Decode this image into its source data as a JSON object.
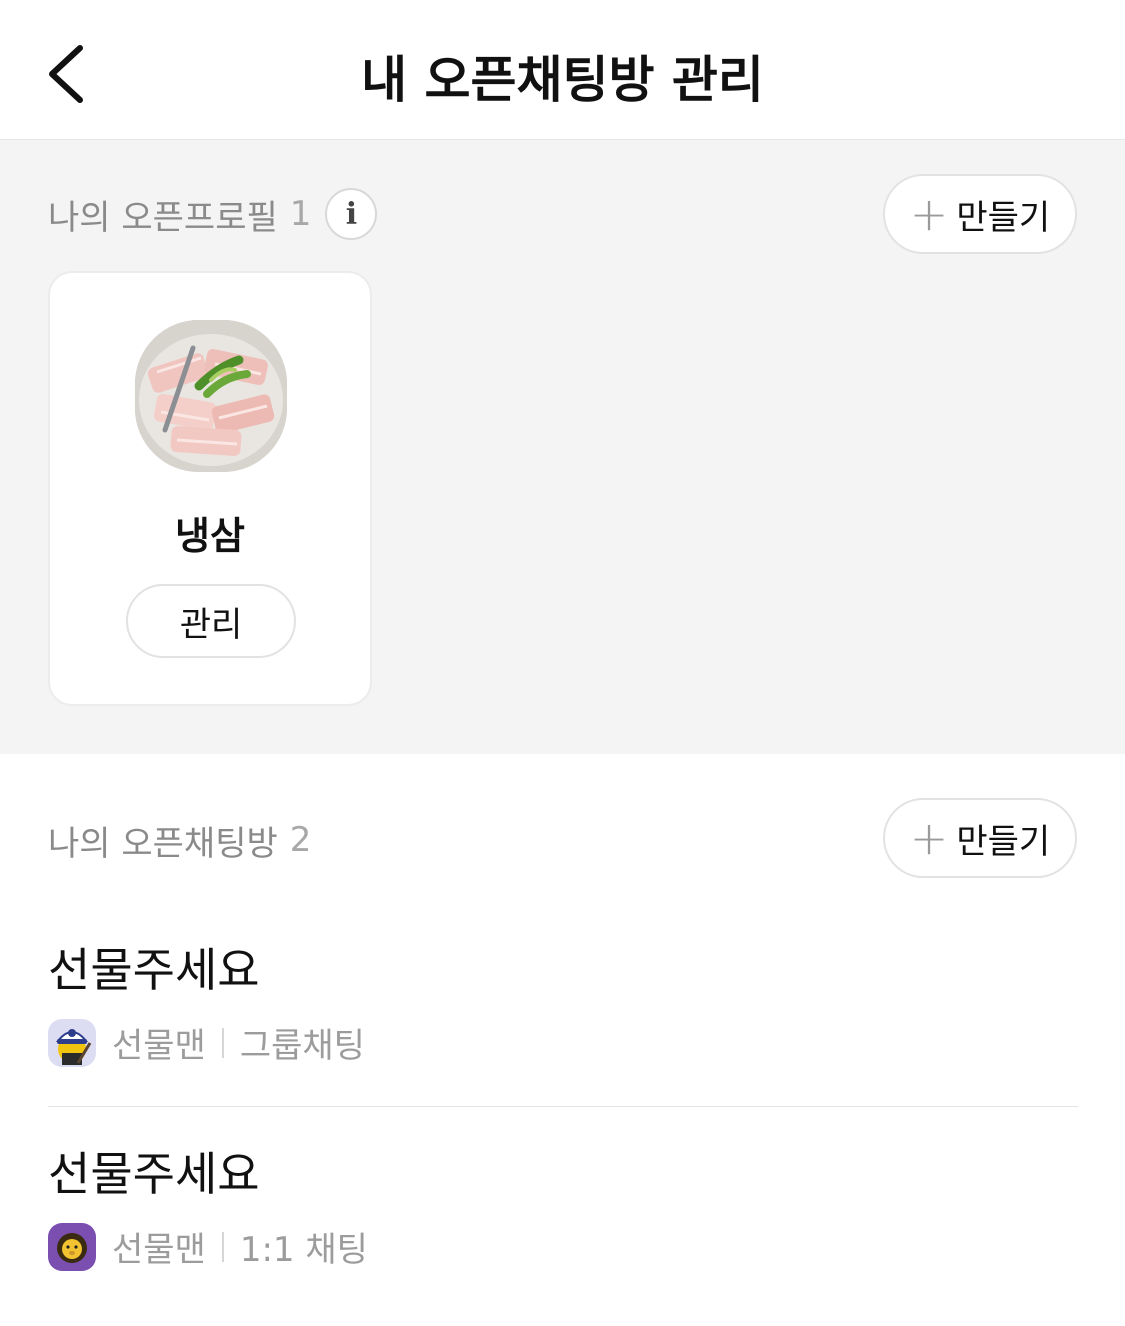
{
  "header": {
    "title": "내 오픈채팅방 관리",
    "back_icon": "chevron-left-icon"
  },
  "profiles": {
    "label": "나의 오픈프로필",
    "count": "1",
    "info_glyph": "i",
    "make_plus": "+",
    "make_label": "만들기",
    "items": [
      {
        "name": "냉삼",
        "manage_label": "관리"
      }
    ]
  },
  "chats": {
    "label": "나의 오픈채팅방",
    "count": "2",
    "make_plus": "+",
    "make_label": "만들기",
    "items": [
      {
        "title": "선물주세요",
        "host": "선물맨",
        "type": "그룹채팅"
      },
      {
        "title": "선물주세요",
        "host": "선물맨",
        "type": "1:1 채팅"
      }
    ]
  }
}
